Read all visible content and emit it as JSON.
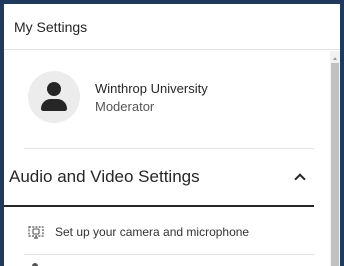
{
  "panel": {
    "title": "My Settings"
  },
  "user": {
    "name": "Winthrop University",
    "role": "Moderator",
    "avatar_icon": "person-icon"
  },
  "section": {
    "title": "Audio and Video Settings",
    "expanded": true,
    "toggle_icon": "chevron-up-icon"
  },
  "options": [
    {
      "label": "Set up your camera and microphone",
      "icon": "camera-microphone-icon"
    }
  ],
  "colors": {
    "frame": "#1f3a5c",
    "text": "#262626",
    "divider": "#e2e2e2",
    "scroll_thumb": "#c1c1c1"
  }
}
